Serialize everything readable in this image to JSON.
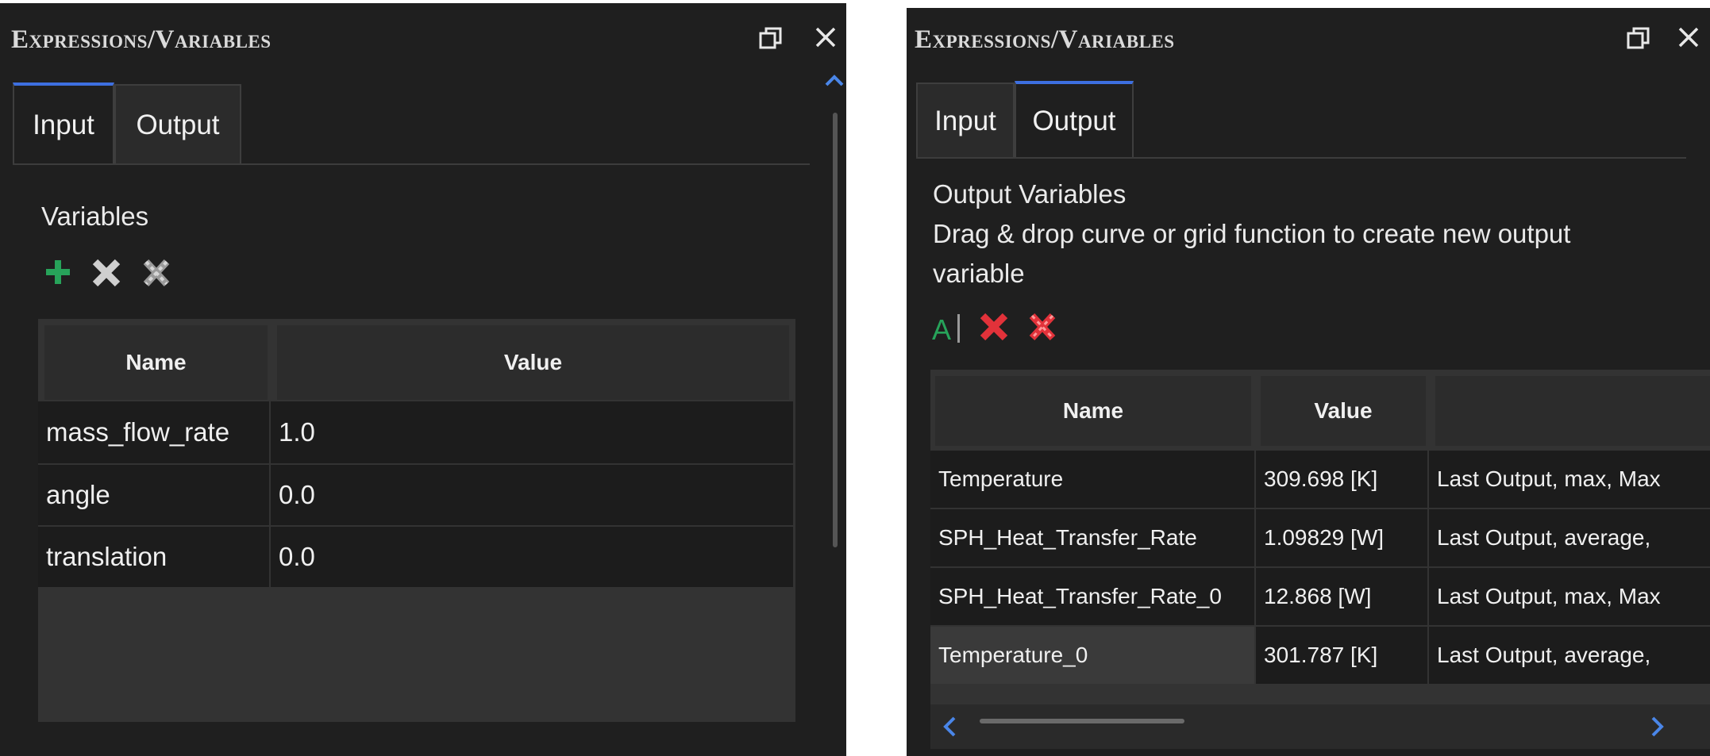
{
  "left": {
    "title": "Expressions/Variables",
    "tabs": [
      {
        "label": "Input",
        "active": true
      },
      {
        "label": "Output",
        "active": false
      }
    ],
    "section_label": "Variables",
    "toolbar_icons": [
      "add-icon",
      "delete-icon",
      "delete-all-icon"
    ],
    "columns": [
      "Name",
      "Value"
    ],
    "rows": [
      {
        "name": "mass_flow_rate",
        "value": "1.0"
      },
      {
        "name": "angle",
        "value": "0.0"
      },
      {
        "name": "translation",
        "value": "0.0"
      }
    ]
  },
  "right": {
    "title": "Expressions/Variables",
    "tabs": [
      {
        "label": "Input",
        "active": false
      },
      {
        "label": "Output",
        "active": true
      }
    ],
    "section_label": "Output Variables",
    "hint_line1": "Drag & drop curve or grid function to create new output",
    "hint_line2": "variable",
    "toolbar_icons": [
      "rename-icon",
      "delete-icon",
      "delete-all-icon"
    ],
    "columns": [
      "Name",
      "Value",
      ""
    ],
    "rows": [
      {
        "name": "Temperature",
        "value": "309.698 [K]",
        "info": "Last Output, max, Max"
      },
      {
        "name": "SPH_Heat_Transfer_Rate",
        "value": "1.09829 [W]",
        "info": "Last Output, average,"
      },
      {
        "name": "SPH_Heat_Transfer_Rate_0",
        "value": "12.868 [W]",
        "info": "Last Output, max, Max"
      },
      {
        "name": "Temperature_0",
        "value": "301.787 [K]",
        "info": "Last Output, average,",
        "selected": true
      }
    ]
  },
  "colors": {
    "panel_bg": "#1f1f1f",
    "active_tab_accent": "#3d6fe0",
    "add_green": "#27a35a",
    "delete_red": "#e2323a",
    "delete_gray": "#cfcfcf",
    "scroll_accent": "#4a86e8"
  }
}
